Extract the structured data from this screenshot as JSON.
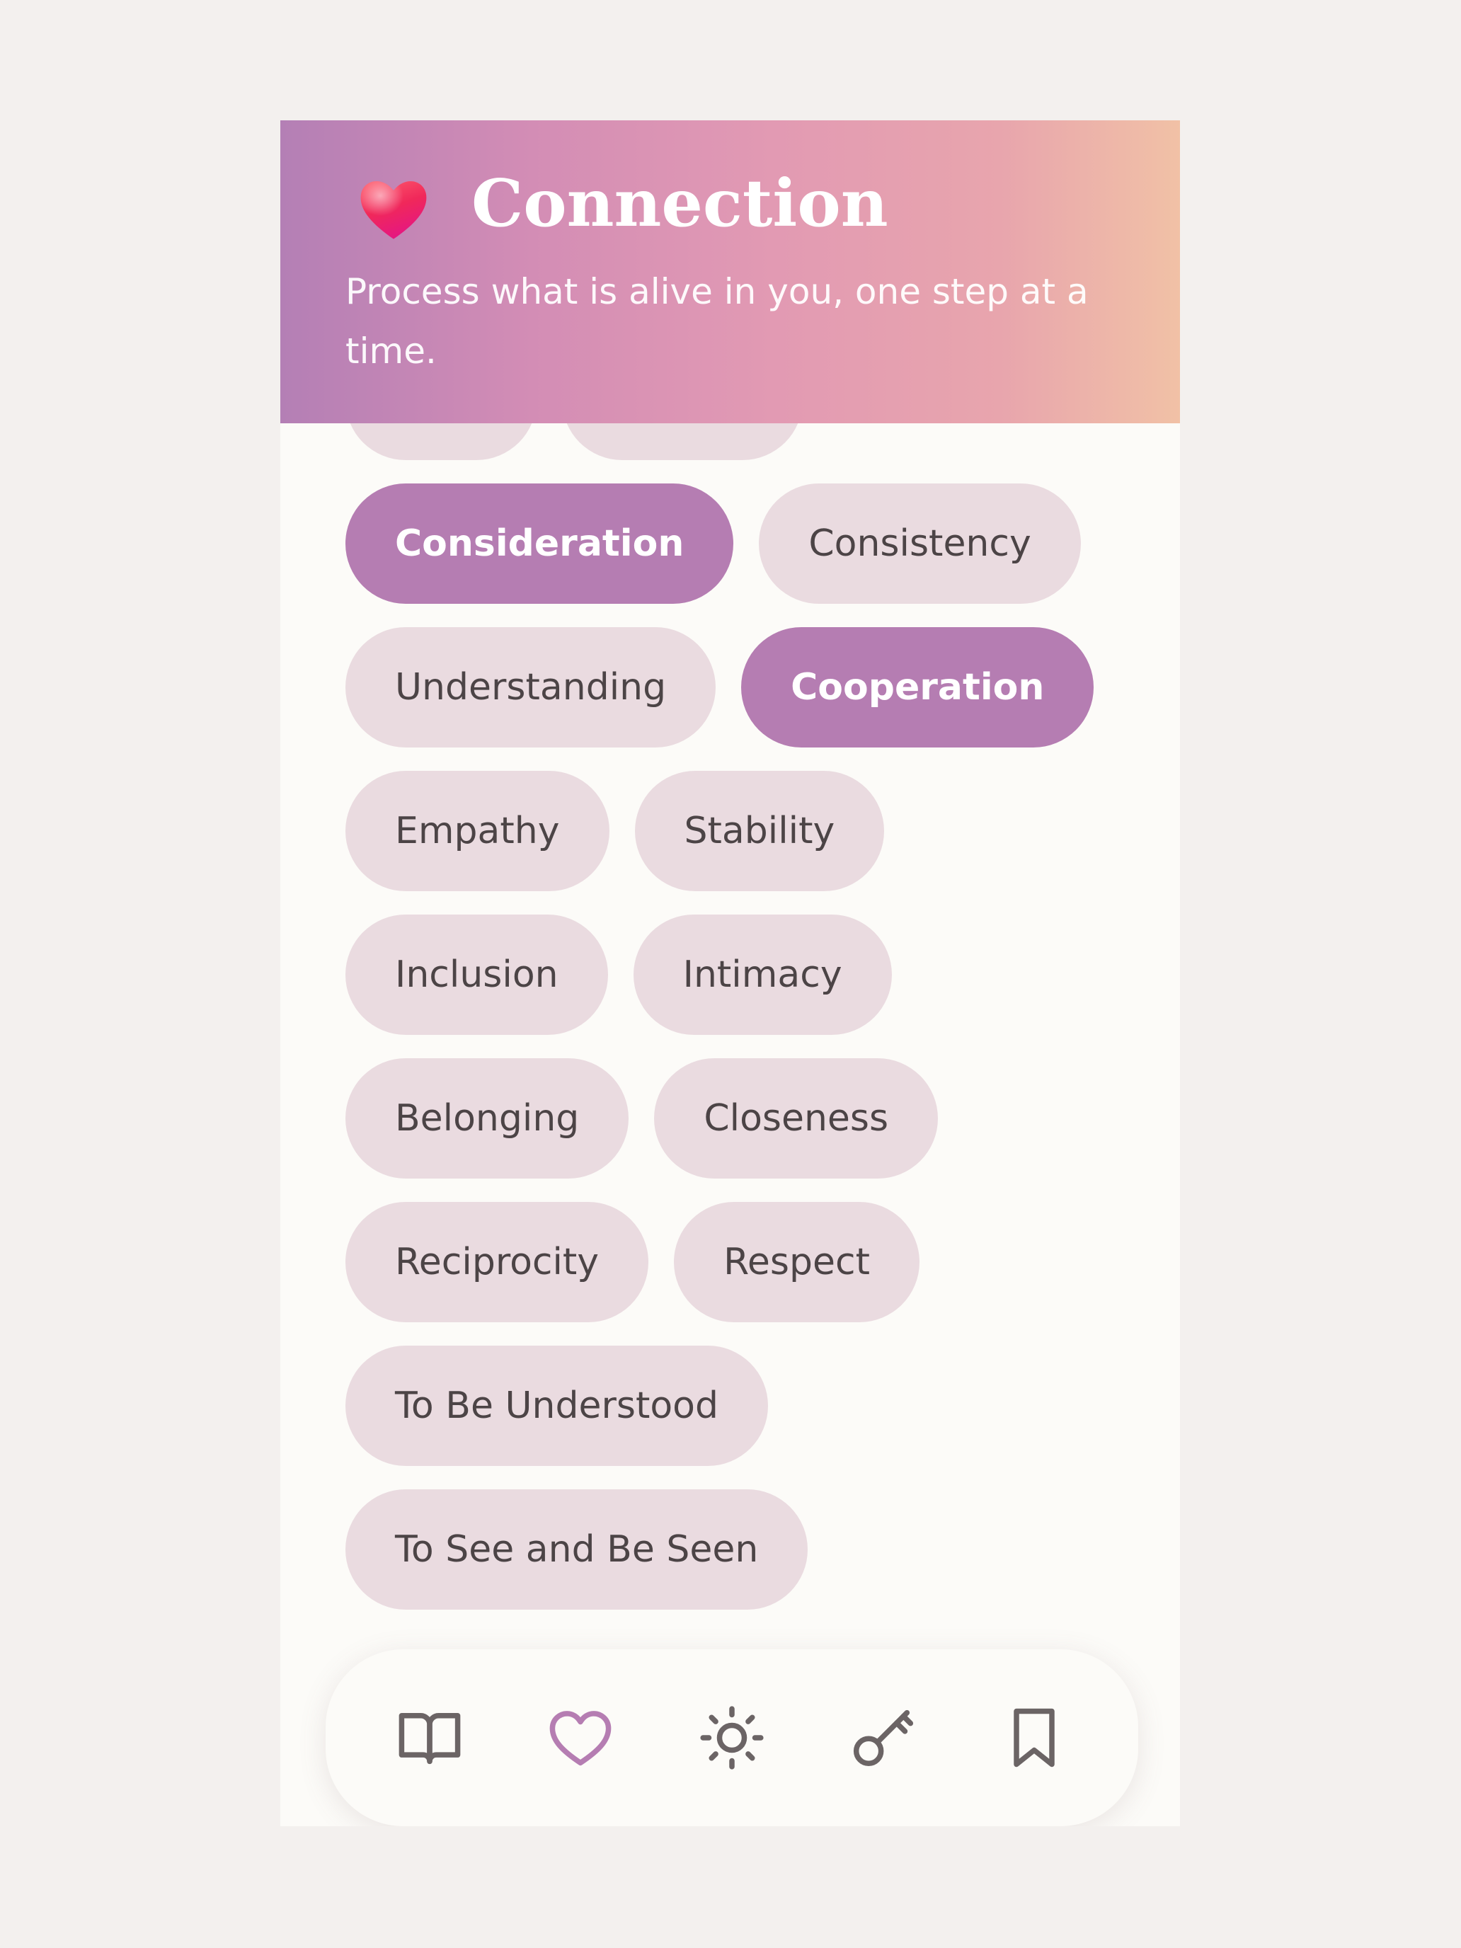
{
  "header": {
    "title": "Connection",
    "subtitle": "Process what is alive in you, one step at a time.",
    "icon": "heart-icon",
    "gradient_colors": [
      "#b47fb5",
      "#d38db5",
      "#e29ab3",
      "#f1c1a6"
    ]
  },
  "needs": [
    [
      {
        "label": "",
        "selected": false
      },
      {
        "label": "",
        "selected": false
      }
    ],
    [
      {
        "label": "Consideration",
        "selected": true
      },
      {
        "label": "Consistency",
        "selected": false
      }
    ],
    [
      {
        "label": "Understanding",
        "selected": false
      },
      {
        "label": "Cooperation",
        "selected": true
      }
    ],
    [
      {
        "label": "Empathy",
        "selected": false
      },
      {
        "label": "Stability",
        "selected": false
      }
    ],
    [
      {
        "label": "Inclusion",
        "selected": false
      },
      {
        "label": "Intimacy",
        "selected": false
      }
    ],
    [
      {
        "label": "Belonging",
        "selected": false
      },
      {
        "label": "Closeness",
        "selected": false
      }
    ],
    [
      {
        "label": "Reciprocity",
        "selected": false
      },
      {
        "label": "Respect",
        "selected": false
      }
    ],
    [
      {
        "label": "To Be Understood",
        "selected": false
      }
    ],
    [
      {
        "label": "To See and Be Seen",
        "selected": false
      }
    ]
  ],
  "nav": [
    {
      "icon": "book-open-icon",
      "active": false
    },
    {
      "icon": "heart-outline-icon",
      "active": true
    },
    {
      "icon": "sun-icon",
      "active": false
    },
    {
      "icon": "key-icon",
      "active": false
    },
    {
      "icon": "bookmark-icon",
      "active": false
    }
  ],
  "colors": {
    "page_background": "#f3f0ee",
    "app_background": "#fcfbf8",
    "chip_background": "#eadbe0",
    "chip_selected": "#b57db2",
    "chip_text": "#4c4446",
    "nav_active": "#b57db2",
    "nav_inactive": "#6b6465"
  }
}
